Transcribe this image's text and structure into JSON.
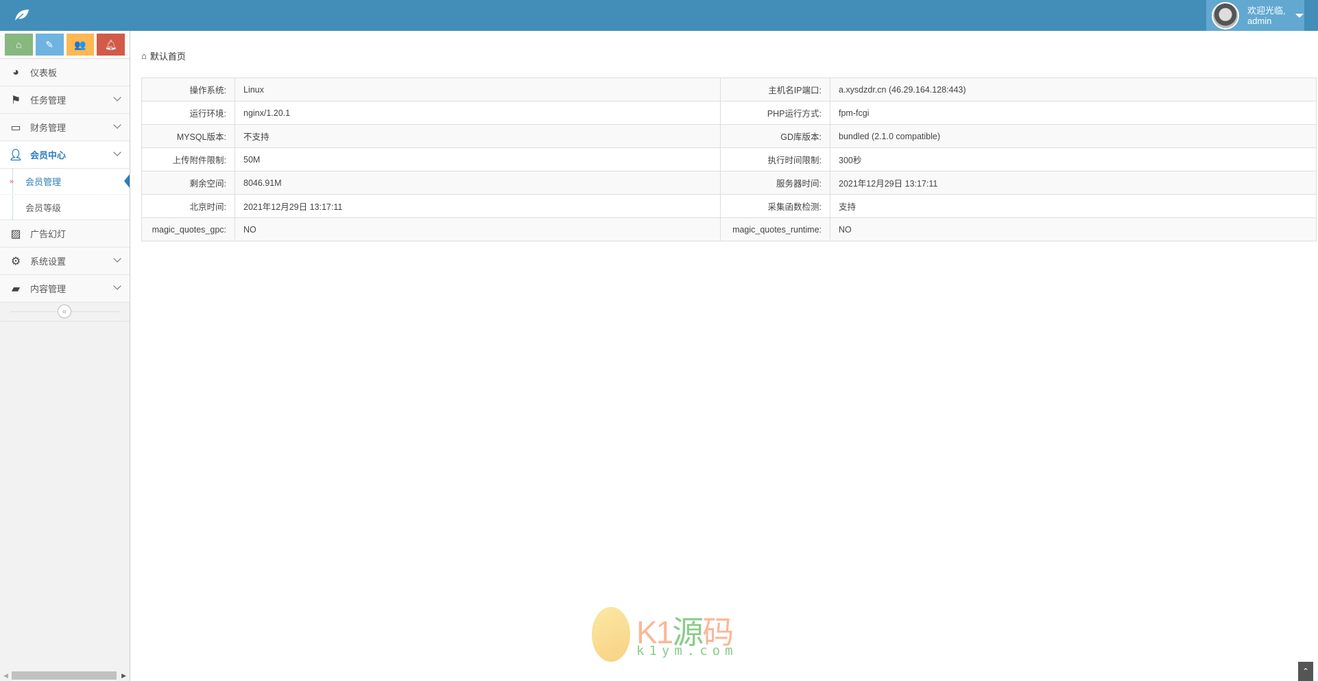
{
  "header": {
    "welcome": "欢迎光临,",
    "username": "admin"
  },
  "shortcuts": [
    {
      "icon": "home-icon",
      "color": "#87b87f"
    },
    {
      "icon": "pencil-icon",
      "color": "#6fb3e0"
    },
    {
      "icon": "users-icon",
      "color": "#ffb752"
    },
    {
      "icon": "bell-icon",
      "color": "#d15b47"
    }
  ],
  "sidebar": {
    "items": [
      {
        "label": "仪表板",
        "icon": "dashboard-icon"
      },
      {
        "label": "任务管理",
        "icon": "flag-icon"
      },
      {
        "label": "财务管理",
        "icon": "hdd-icon"
      },
      {
        "label": "会员中心",
        "icon": "user-icon"
      },
      {
        "label": "广告幻灯",
        "icon": "picture-icon"
      },
      {
        "label": "系统设置",
        "icon": "gear-icon"
      },
      {
        "label": "内容管理",
        "icon": "book-icon"
      }
    ],
    "submenu": [
      {
        "label": "会员管理"
      },
      {
        "label": "会员等级"
      }
    ],
    "collapse_glyph": "«"
  },
  "breadcrumb": "默认首页",
  "info_table": [
    {
      "k1": "操作系统:",
      "v1": "Linux",
      "k2": "主机名IP端口:",
      "v2": "a.xysdzdr.cn (46.29.164.128:443)"
    },
    {
      "k1": "运行环境:",
      "v1": "nginx/1.20.1",
      "k2": "PHP运行方式:",
      "v2": "fpm-fcgi"
    },
    {
      "k1": "MYSQL版本:",
      "v1": "不支持",
      "k2": "GD库版本:",
      "v2": "bundled (2.1.0 compatible)"
    },
    {
      "k1": "上传附件限制:",
      "v1": "50M",
      "k2": "执行时间限制:",
      "v2": "300秒"
    },
    {
      "k1": "剩余空间:",
      "v1": "8046.91M",
      "k2": "服务器时间:",
      "v2": "2021年12月29日 13:17:11"
    },
    {
      "k1": "北京时间:",
      "v1": "2021年12月29日 13:17:11",
      "k2": "采集函数检测:",
      "v2": "支持"
    },
    {
      "k1": "magic_quotes_gpc:",
      "v1": "NO",
      "k2": "magic_quotes_runtime:",
      "v2": "NO"
    }
  ],
  "watermark": {
    "brand": "K1",
    "brand_cn1": "源",
    "brand_cn2": "码",
    "domain": "k1ym.com"
  }
}
